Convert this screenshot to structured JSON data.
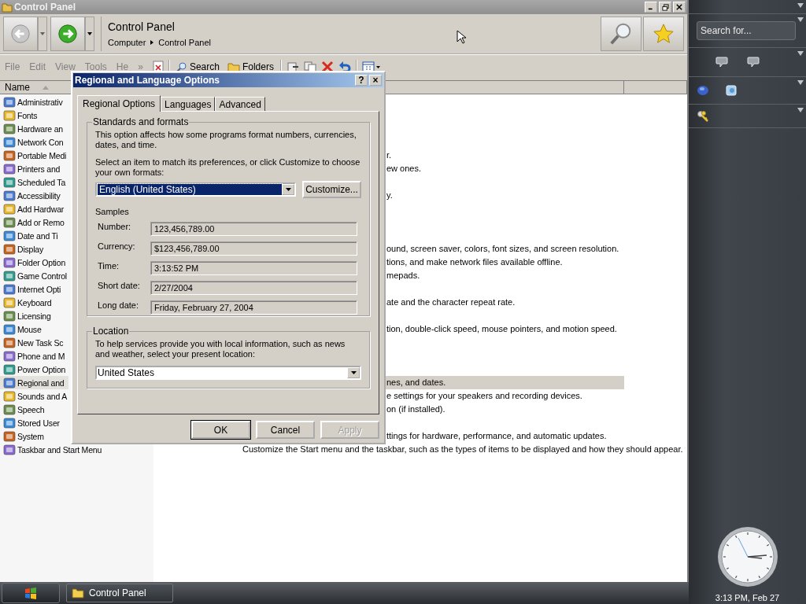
{
  "window": {
    "title": "Control Panel"
  },
  "address": {
    "title": "Control Panel",
    "breadcrumb": [
      "Computer",
      "Control Panel"
    ]
  },
  "menu": [
    "File",
    "Edit",
    "View",
    "Tools",
    "He"
  ],
  "toolbar": {
    "overflow": "»",
    "buttons": [
      "Search",
      "Folders"
    ]
  },
  "columns": [
    {
      "label": "Name",
      "sorted": true
    }
  ],
  "rows": [
    {
      "name": "Administrativ",
      "description": "",
      "selected": false
    },
    {
      "name": "Fonts",
      "description": "",
      "selected": false
    },
    {
      "name": "Hardware an",
      "description": "",
      "selected": false
    },
    {
      "name": "Network Con",
      "description": "",
      "selected": false
    },
    {
      "name": "Portable Medi",
      "description": "r.",
      "selected": false
    },
    {
      "name": "Printers and",
      "description": "ew ones.",
      "selected": false
    },
    {
      "name": "Scheduled Ta",
      "description": "",
      "selected": false
    },
    {
      "name": "Accessibility",
      "description": "y.",
      "selected": false
    },
    {
      "name": "Add Hardwar",
      "description": "",
      "selected": false
    },
    {
      "name": "Add or Remo",
      "description": "",
      "selected": false
    },
    {
      "name": "Date and Ti",
      "description": "",
      "selected": false
    },
    {
      "name": "Display",
      "description": "ound, screen saver, colors, font sizes, and screen resolution.",
      "selected": false
    },
    {
      "name": "Folder Option",
      "description": "tions, and make network files available offline.",
      "selected": false
    },
    {
      "name": "Game Control",
      "description": "mepads.",
      "selected": false
    },
    {
      "name": "Internet Opti",
      "description": "",
      "selected": false
    },
    {
      "name": "Keyboard",
      "description": "ate and the character repeat rate.",
      "selected": false
    },
    {
      "name": "Licensing",
      "description": "",
      "selected": false
    },
    {
      "name": "Mouse",
      "description": "tion, double-click speed, mouse pointers, and motion speed.",
      "selected": false
    },
    {
      "name": "New Task Sc",
      "description": "",
      "selected": false
    },
    {
      "name": "Phone and M",
      "description": "",
      "selected": false
    },
    {
      "name": "Power Option",
      "description": "",
      "selected": false
    },
    {
      "name": "Regional and",
      "description": "nes, and dates.",
      "selected": true
    },
    {
      "name": "Sounds and A",
      "description": "e settings for your speakers and recording devices.",
      "selected": false
    },
    {
      "name": "Speech",
      "description": "on (if installed).",
      "selected": false
    },
    {
      "name": "Stored User",
      "description": "",
      "selected": false
    },
    {
      "name": "System",
      "description": "ttings for hardware, performance, and automatic updates.",
      "selected": false
    },
    {
      "name": "Taskbar and Start Menu",
      "description": "Customize the Start menu and the taskbar, such as the types of items to be displayed and how they should appear.",
      "selected": false
    }
  ],
  "dialog": {
    "title": "Regional and Language Options",
    "help": "?",
    "close": "×",
    "tabs": [
      {
        "label": "Regional Options",
        "selected": true
      },
      {
        "label": "Languages",
        "selected": false
      },
      {
        "label": "Advanced",
        "selected": false
      }
    ],
    "standards": {
      "title": "Standards and formats",
      "intro": "This option affects how some programs format numbers, currencies, dates, and time.",
      "prompt": "Select an item to match its preferences, or click Customize to choose your own formats:",
      "format": "English (United States)",
      "customize": "Customize...",
      "samples_title": "Samples",
      "samples": [
        {
          "label": "Number:",
          "value": "123,456,789.00"
        },
        {
          "label": "Currency:",
          "value": "$123,456,789.00"
        },
        {
          "label": "Time:",
          "value": "3:13:52 PM"
        },
        {
          "label": "Short date:",
          "value": "2/27/2004"
        },
        {
          "label": "Long date:",
          "value": "Friday, February 27, 2004"
        }
      ]
    },
    "location": {
      "title": "Location",
      "prompt": "To help services provide you with local information, such as news and weather, select your present location:",
      "value": "United States"
    },
    "buttons": [
      {
        "label": "OK",
        "disabled": false
      },
      {
        "label": "Cancel",
        "disabled": false
      },
      {
        "label": "Apply",
        "disabled": true
      }
    ]
  },
  "sidebar": {
    "search": {
      "placeholder": "Search for..."
    },
    "clock_caption": "3:13 PM, Feb 27"
  },
  "taskbar": {
    "tasks": [
      {
        "label": "Control Panel",
        "selected": false
      }
    ]
  }
}
